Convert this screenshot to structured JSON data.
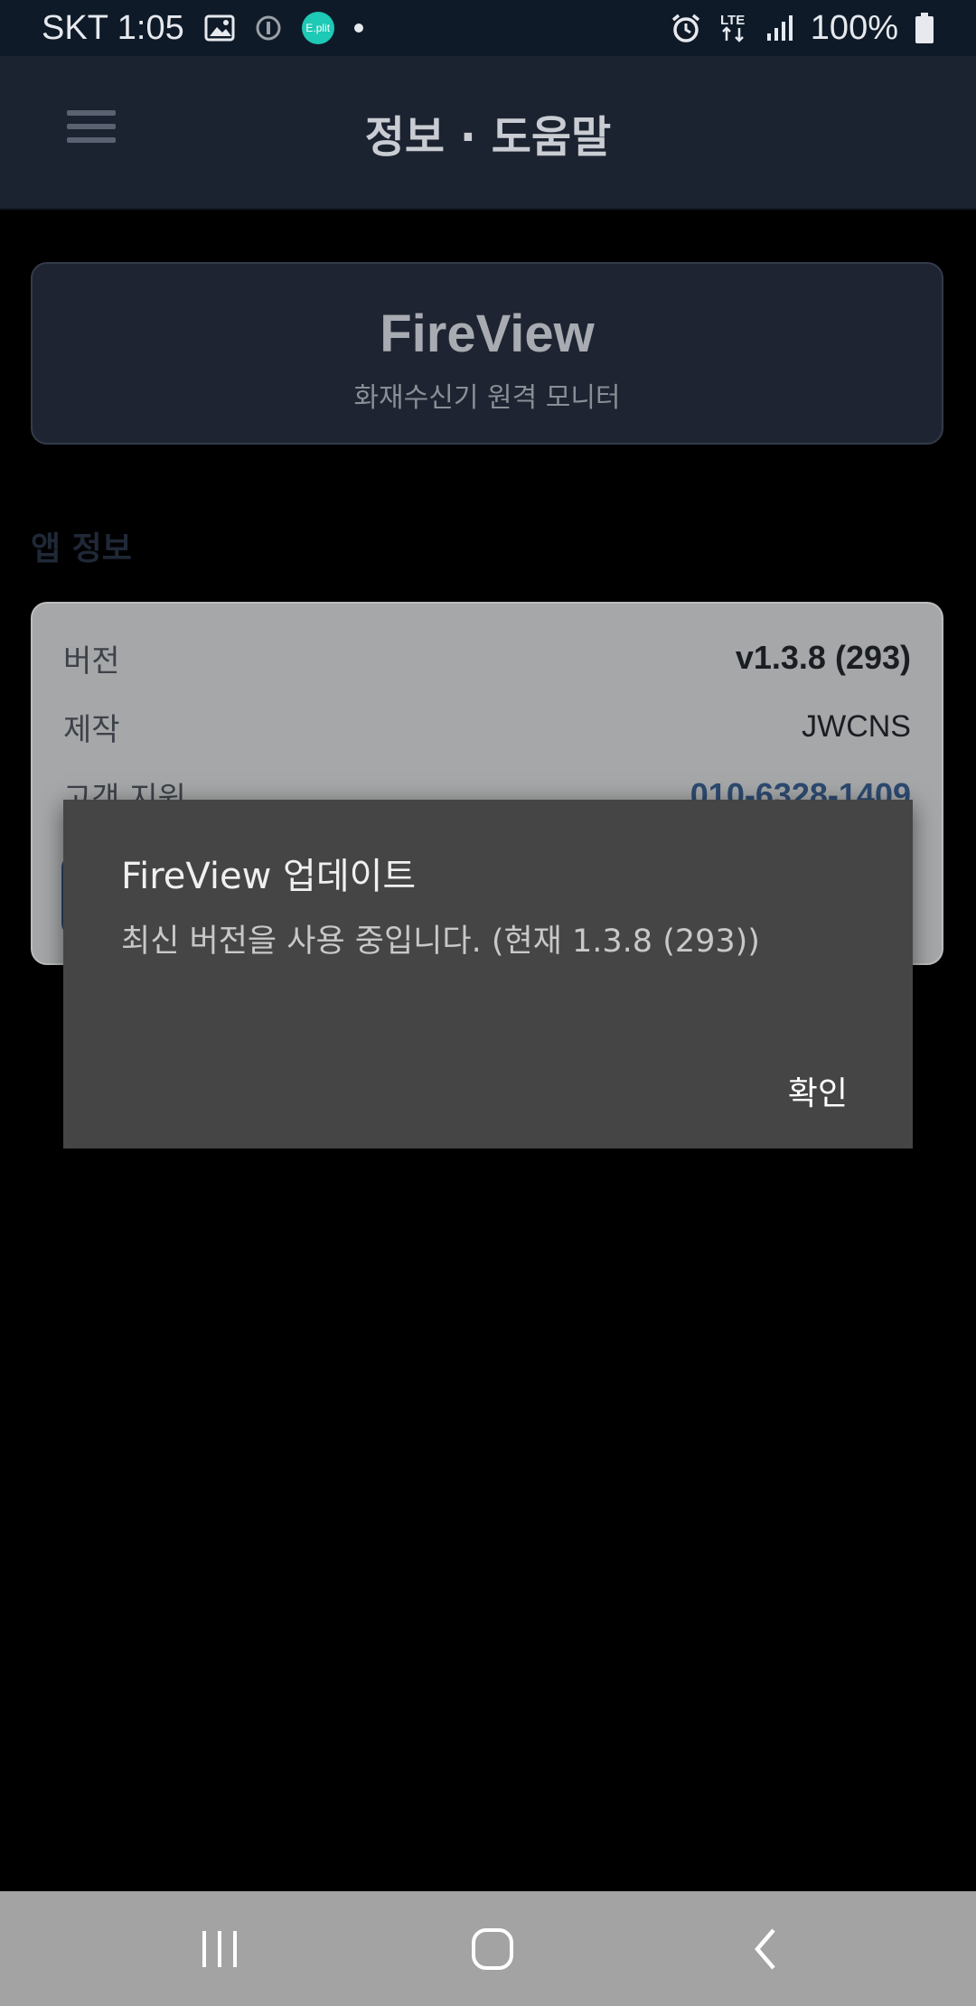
{
  "status_bar": {
    "carrier_time": "SKT 1:05",
    "eplit_badge": "E.plit",
    "network": "LTE",
    "battery": "100%"
  },
  "app_bar": {
    "title": "정보 · 도움말"
  },
  "hero": {
    "app_name": "FireView",
    "subtitle": "화재수신기 원격 모니터"
  },
  "section": {
    "app_info_title": "앱 정보"
  },
  "info": {
    "rows": [
      {
        "label": "버전",
        "value": "v1.3.8 (293)"
      },
      {
        "label": "제작",
        "value": "JWCNS"
      },
      {
        "label": "고객 지원",
        "value": "010-6328-1409"
      }
    ]
  },
  "dialog": {
    "title": "FireView 업데이트",
    "message": "최신 버전을 사용 중입니다. (현재 1.3.8 (293))",
    "ok_label": "확인"
  },
  "colors": {
    "status_bar_bg": "#0f1a28",
    "app_bar_bg": "#1c2330",
    "dialog_bg": "#454545",
    "link": "#2d4a70"
  },
  "icons": [
    "image-icon",
    "info-circle-icon",
    "alarm-icon",
    "signal-icon",
    "battery-icon",
    "menu-icon",
    "recent-apps-icon",
    "home-icon",
    "back-icon"
  ]
}
